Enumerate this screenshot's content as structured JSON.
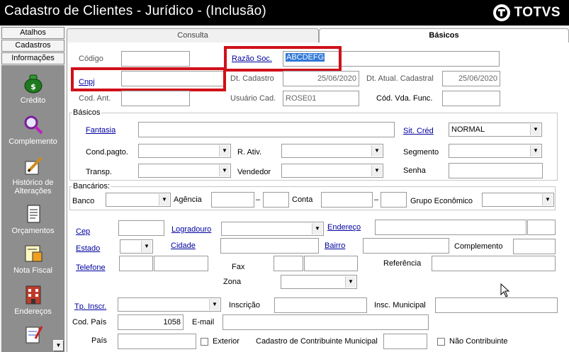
{
  "window": {
    "title": "Cadastro de Clientes - Jurídico  -  (Inclusão)",
    "brand": "TOTVS"
  },
  "sidebar": {
    "tabs": [
      "Atalhos",
      "Cadastros",
      "Informações"
    ],
    "items": [
      {
        "label": "Crédito",
        "icon": "money-bag-icon"
      },
      {
        "label": "Complemento",
        "icon": "magnifier-icon"
      },
      {
        "label": "Histórico de Alterações",
        "icon": "pencil-icon"
      },
      {
        "label": "Orçamentos",
        "icon": "document-icon"
      },
      {
        "label": "Nota Fiscal",
        "icon": "invoice-icon"
      },
      {
        "label": "Endereços",
        "icon": "building-icon"
      }
    ]
  },
  "tabs": {
    "consulta": "Consulta",
    "basicos": "Básicos"
  },
  "form": {
    "codigo": {
      "label": "Código",
      "value": ""
    },
    "razao_soc": {
      "label": "Razão Soc.",
      "value": "ABCDEFG"
    },
    "cnpj": {
      "label": "Cnpj",
      "value": ""
    },
    "dt_cadastro": {
      "label": "Dt. Cadastro",
      "value": "25/06/2020"
    },
    "dt_atual_cadastral": {
      "label": "Dt. Atual. Cadastral",
      "value": "25/06/2020"
    },
    "cod_ant": {
      "label": "Cod. Ant.",
      "value": ""
    },
    "usuario_cad": {
      "label": "Usuário Cad.",
      "value": "ROSE01"
    },
    "cod_vda_func": {
      "label": "Cód. Vda. Func.",
      "value": ""
    }
  },
  "basicos": {
    "title": "Básicos",
    "fantasia": {
      "label": "Fantasia",
      "value": ""
    },
    "sit_cred": {
      "label": "Sit. Créd",
      "value": "NORMAL"
    },
    "cond_pagto": {
      "label": "Cond.pagto.",
      "value": ""
    },
    "r_ativ": {
      "label": "R. Ativ.",
      "value": ""
    },
    "segmento": {
      "label": "Segmento",
      "value": ""
    },
    "transp": {
      "label": "Transp.",
      "value": ""
    },
    "vendedor": {
      "label": "Vendedor",
      "value": ""
    },
    "senha": {
      "label": "Senha",
      "value": ""
    }
  },
  "bancarios": {
    "title": "Bancários:",
    "banco": "Banco",
    "agencia": "Agência",
    "dash": "–",
    "conta": "Conta",
    "grupo_economico": "Grupo Econômico"
  },
  "address": {
    "cep": "Cep",
    "logradouro": "Logradouro",
    "endereco": "Endereço",
    "estado": "Estado",
    "cidade": "Cidade",
    "bairro": "Bairro",
    "complemento": "Complemento",
    "telefone": "Telefone",
    "fax": "Fax",
    "referencia": "Referência",
    "zona": "Zona",
    "tp_inscr": "Tp. Inscr.",
    "inscricao": "Inscrição",
    "insc_municipal": "Insc. Municipal",
    "cod_pais": {
      "label": "Cod. País",
      "value": "1058"
    },
    "email": "E-mail",
    "pais": "País",
    "exterior": "Exterior",
    "cadastro_contribuinte": "Cadastro de Contribuinte Municipal",
    "nao_contribuinte": "Não Contribuinte"
  },
  "colors": {
    "highlight": "#d0101a",
    "link": "#0000a0",
    "sidebar": "#8e8e8e",
    "titlebar": "#000000"
  }
}
